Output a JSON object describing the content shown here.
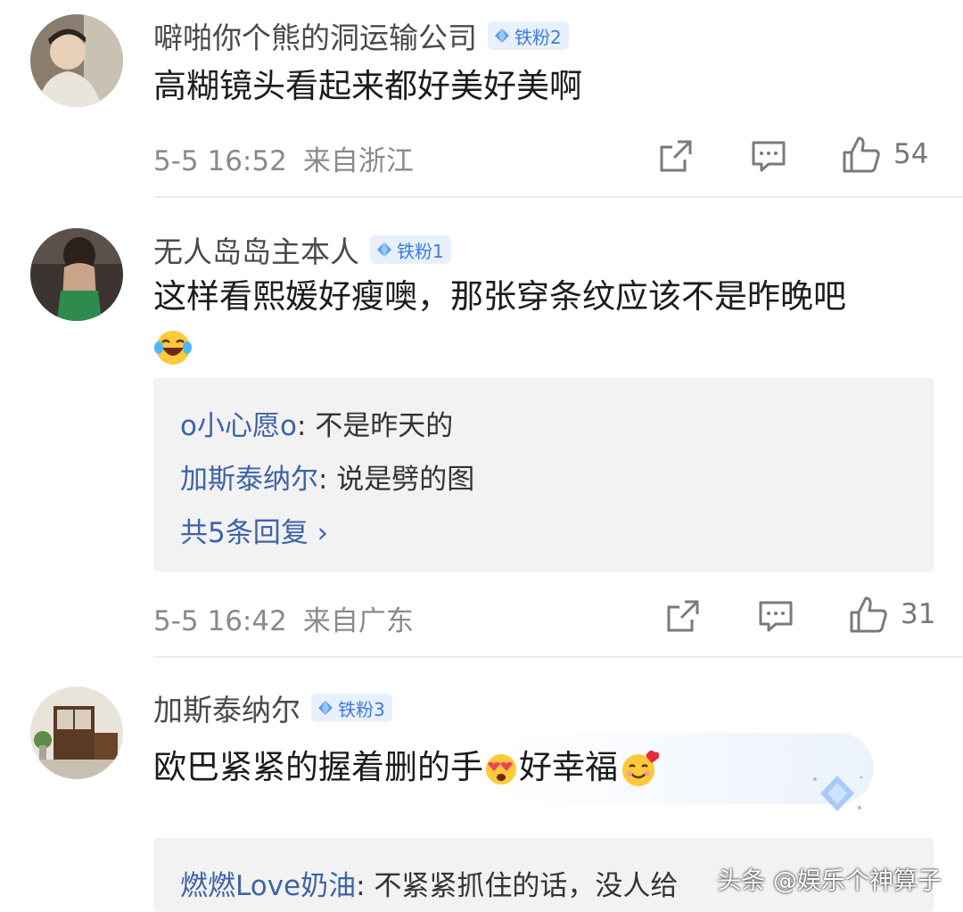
{
  "comments": [
    {
      "username": "噼啪你个熊的洞运输公司",
      "badge": "铁粉2",
      "text": "高糊镜头看起来都好美好美啊",
      "time": "5-5 16:52",
      "location": "来自浙江",
      "likes": "54"
    },
    {
      "username": "无人岛岛主本人",
      "badge": "铁粉1",
      "text": "这样看熙媛好瘦噢，那张穿条纹应该不是昨晚吧",
      "emoji_icon": "laughing-tears-emoji",
      "replies": [
        {
          "name": "o小心愿o",
          "text": ": 不是昨天的"
        },
        {
          "name": "加斯泰纳尔",
          "text": ": 说是劈的图"
        }
      ],
      "more_replies": "共5条回复 ›",
      "time": "5-5 16:42",
      "location": "来自广东",
      "likes": "31"
    },
    {
      "username": "加斯泰纳尔",
      "badge": "铁粉3",
      "text_a": "欧巴紧紧的握着删的手",
      "text_b": "好幸福",
      "replies": [
        {
          "name": "燃燃Love奶油",
          "text": ": 不紧紧抓住的话，没人给"
        }
      ]
    }
  ],
  "watermark": "头条 @娱乐个神算子",
  "colors": {
    "accent_link": "#3d63a8",
    "badge_text": "#3a7be0",
    "badge_bg": "#e8f0fb",
    "meta_gray": "#8a8a8a"
  }
}
